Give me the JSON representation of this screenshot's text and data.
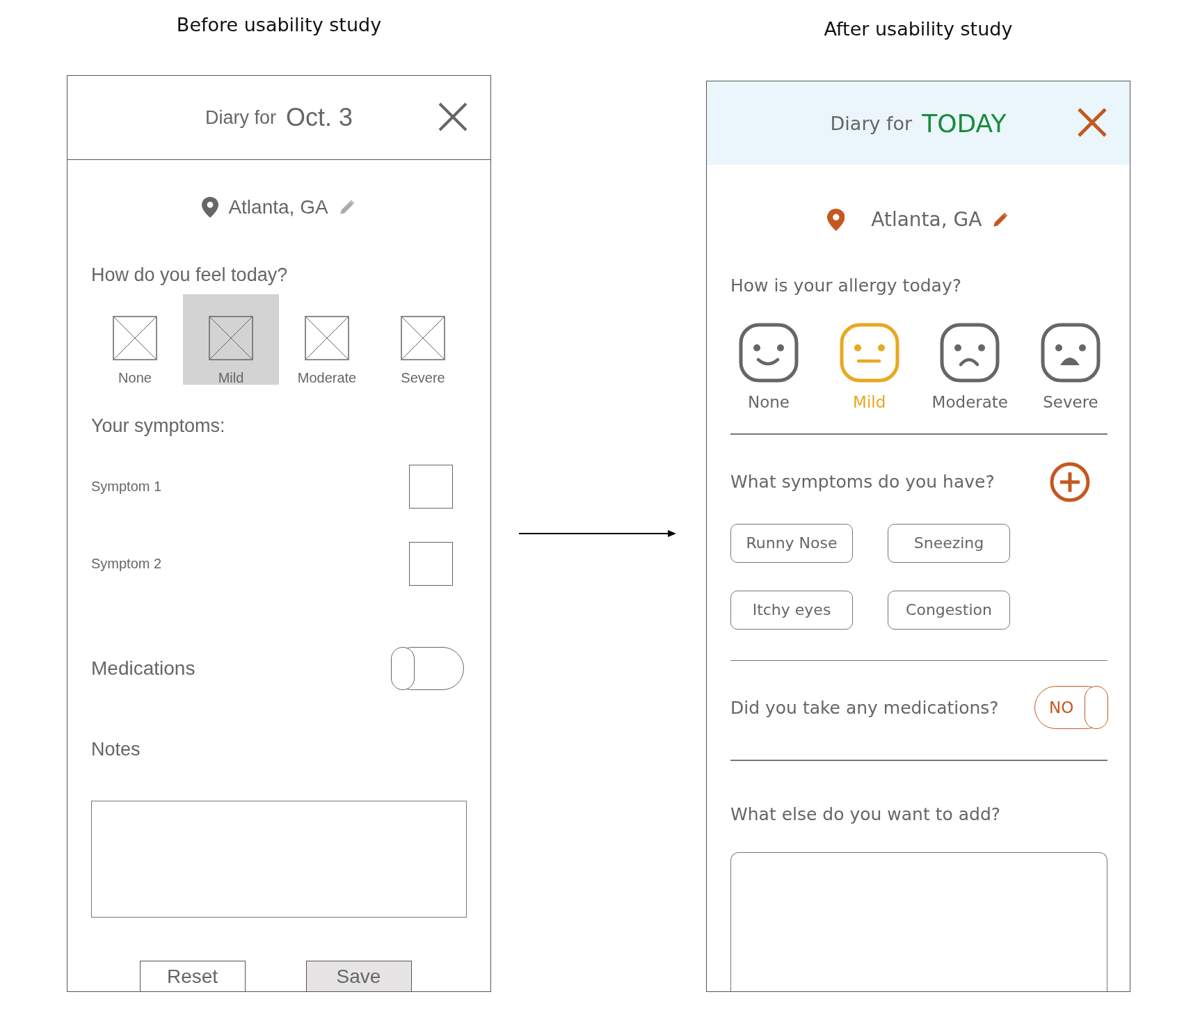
{
  "before": {
    "caption": "Before usability study",
    "header": {
      "prefix": "Diary for",
      "date": "Oct. 3"
    },
    "location": "Atlanta, GA",
    "question": "How do you feel today?",
    "options": [
      {
        "label": "None",
        "selected": false
      },
      {
        "label": "Mild",
        "selected": true
      },
      {
        "label": "Moderate",
        "selected": false
      },
      {
        "label": "Severe",
        "selected": false
      }
    ],
    "symptoms_heading": "Your symptoms:",
    "symptoms": [
      {
        "label": "Symptom 1",
        "checked": false
      },
      {
        "label": "Symptom 2",
        "checked": false
      }
    ],
    "medications": {
      "label": "Medications",
      "on": false
    },
    "notes_label": "Notes",
    "buttons": [
      {
        "label": "Reset",
        "primary": false
      },
      {
        "label": "Save",
        "primary": true
      }
    ]
  },
  "after": {
    "caption": "After usability study",
    "header": {
      "prefix": "Diary for",
      "date": "TODAY"
    },
    "location": "Atlanta, GA",
    "question": "How is your allergy today?",
    "options": [
      {
        "label": "None",
        "kind": "smile",
        "selected": false
      },
      {
        "label": "Mild",
        "kind": "neutral",
        "selected": true
      },
      {
        "label": "Moderate",
        "kind": "frown",
        "selected": false
      },
      {
        "label": "Severe",
        "kind": "open",
        "selected": false
      }
    ],
    "symptoms_question": "What symptoms do you have?",
    "chips": [
      "Runny Nose",
      "Sneezing",
      "Itchy eyes",
      "Congestion"
    ],
    "medications": {
      "label": "Did you take any medications?",
      "toggle_text": "NO",
      "on": false
    },
    "notes_question": "What else do you want to add?"
  }
}
